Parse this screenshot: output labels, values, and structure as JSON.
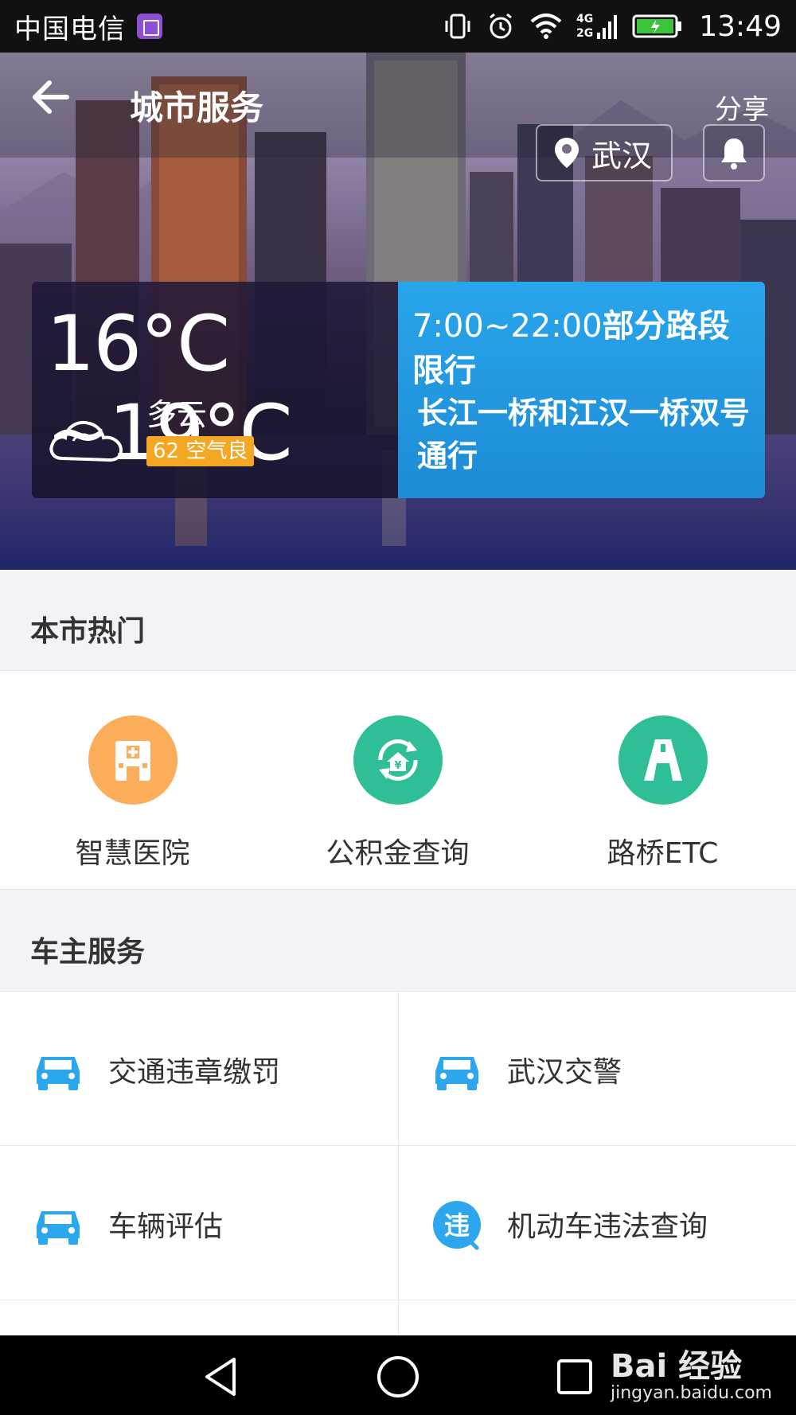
{
  "status_bar": {
    "carrier": "中国电信",
    "network": "4G 2G",
    "time": "13:49"
  },
  "header": {
    "title": "城市服务",
    "share_label": "分享",
    "city": "武汉"
  },
  "weather": {
    "temperature": "16°C ~19°C",
    "condition": "多云",
    "aqi": "62 空气良"
  },
  "traffic": {
    "time": "7:00~22:00",
    "restriction": "部分路段",
    "restriction_cont": "限行",
    "detail": "长江一桥和江汉一桥双号通行"
  },
  "hot_section": {
    "title": "本市热门",
    "items": [
      {
        "label": "智慧医院",
        "icon": "hospital-icon",
        "color": "#fcad5a"
      },
      {
        "label": "公积金查询",
        "icon": "housing-fund-icon",
        "color": "#2fbf97"
      },
      {
        "label": "路桥ETC",
        "icon": "road-icon",
        "color": "#2fbf97"
      }
    ]
  },
  "owner_section": {
    "title": "车主服务",
    "items": [
      {
        "label": "交通违章缴罚",
        "icon": "car-icon"
      },
      {
        "label": "武汉交警",
        "icon": "car-icon"
      },
      {
        "label": "车辆评估",
        "icon": "car-icon"
      },
      {
        "label": "机动车违法查询",
        "icon": "violation-icon",
        "icon_text": "违"
      }
    ],
    "accent": "#2ca6ec"
  },
  "watermark": {
    "logo": "Bai 经验",
    "url": "jingyan.baidu.com"
  }
}
